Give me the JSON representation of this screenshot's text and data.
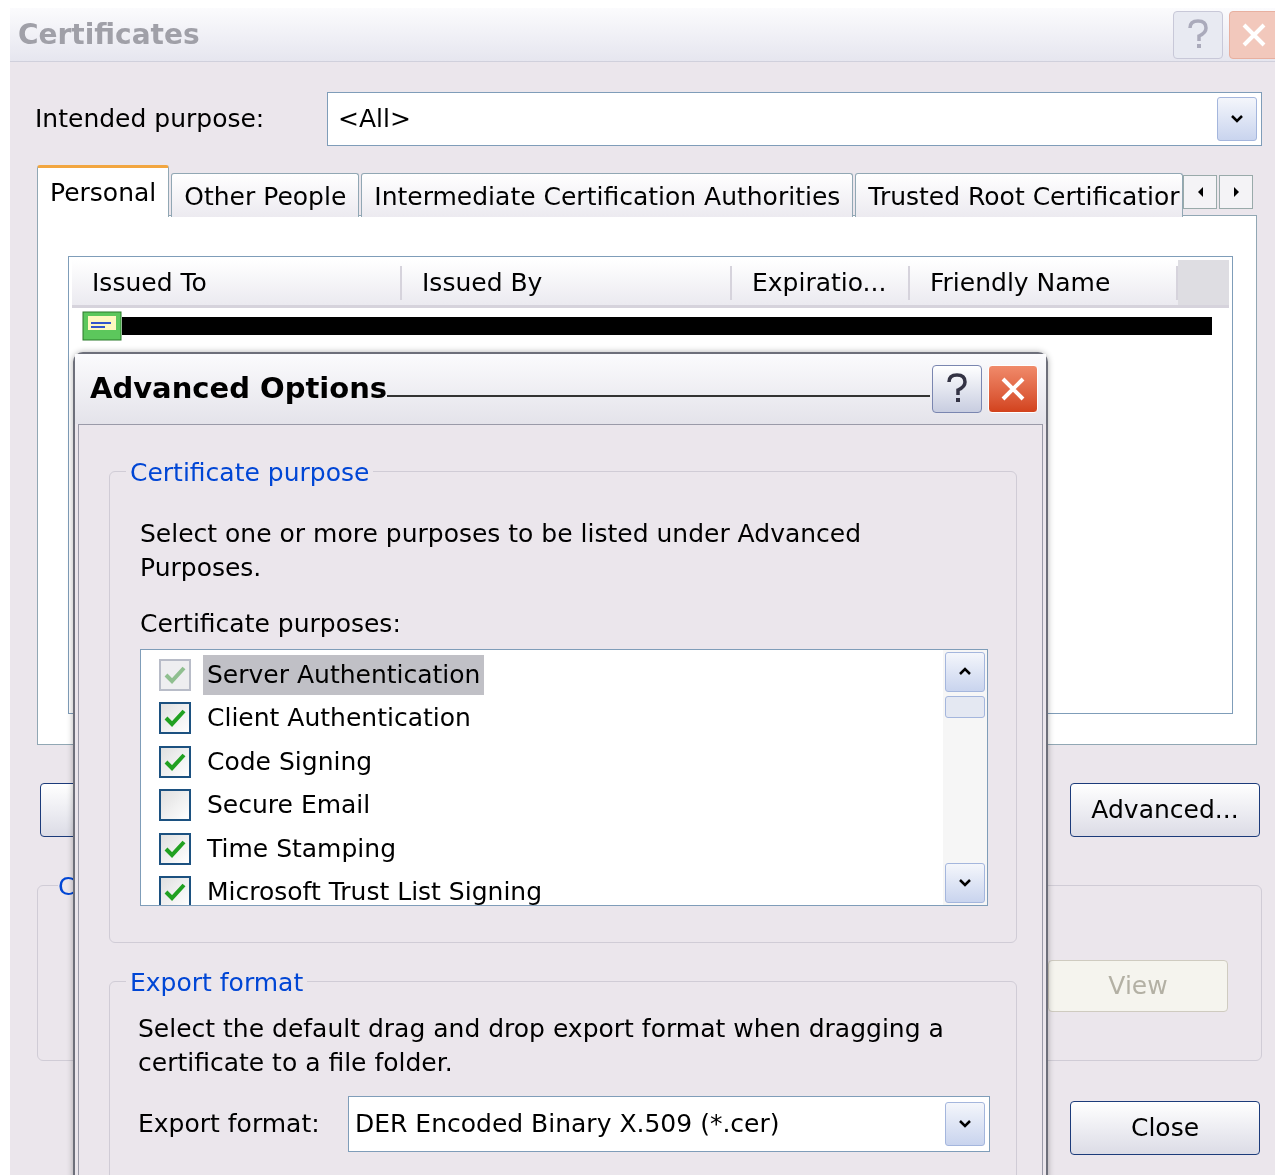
{
  "window": {
    "title": "Certificates"
  },
  "intended_purpose": {
    "label": "Intended purpose:",
    "value": "<All>"
  },
  "tabs": [
    {
      "label": "Personal",
      "selected": true
    },
    {
      "label": "Other People",
      "selected": false
    },
    {
      "label": "Intermediate Certification Authorities",
      "selected": false
    },
    {
      "label": "Trusted Root Certificatior",
      "selected": false
    }
  ],
  "table": {
    "columns": [
      "Issued To",
      "Issued By",
      "Expiratio...",
      "Friendly Name"
    ]
  },
  "buttons": {
    "advanced": "Advanced...",
    "view": {
      "label": "View",
      "disabled": true
    },
    "close": "Close"
  },
  "group": {
    "label": "C"
  },
  "advanced_dialog": {
    "title": "Advanced Options",
    "purpose_group": {
      "label": "Certificate purpose",
      "description": "Select one or more purposes to be listed under Advanced Purposes.",
      "list_label": "Certificate purposes:",
      "items": [
        {
          "label": "Server Authentication",
          "checked": true,
          "selected": true,
          "disabled": true
        },
        {
          "label": "Client Authentication",
          "checked": true,
          "selected": false,
          "disabled": false
        },
        {
          "label": "Code Signing",
          "checked": true,
          "selected": false,
          "disabled": false
        },
        {
          "label": "Secure Email",
          "checked": false,
          "selected": false,
          "disabled": false
        },
        {
          "label": "Time Stamping",
          "checked": true,
          "selected": false,
          "disabled": false
        },
        {
          "label": "Microsoft Trust List Signing",
          "checked": true,
          "selected": false,
          "disabled": false
        }
      ]
    },
    "export_group": {
      "label": "Export format",
      "description": "Select the default drag and drop export format when dragging a certificate to a file folder.",
      "field_label": "Export format:",
      "value": "DER Encoded Binary X.509 (*.cer)"
    }
  }
}
